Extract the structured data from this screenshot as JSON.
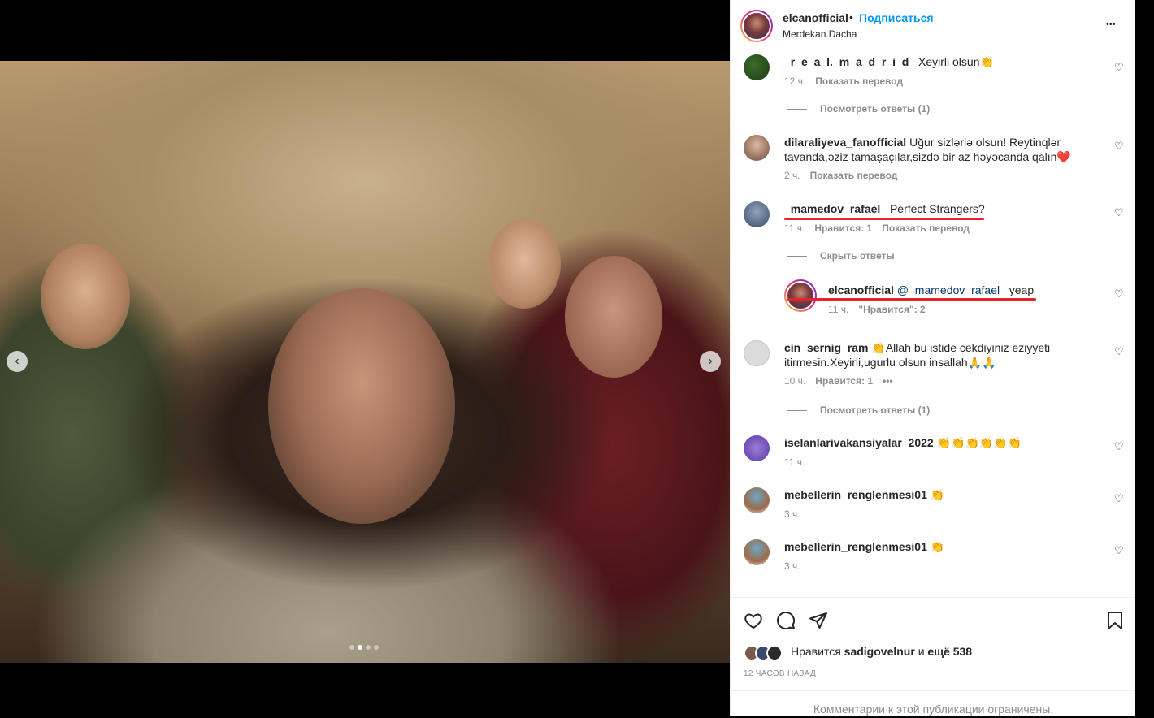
{
  "post": {
    "username": "elcanofficial",
    "separator": "•",
    "follow_label": "Подписаться",
    "location": "Merdekan.Dacha",
    "more_label": "•••"
  },
  "media": {
    "prev_label": "‹",
    "next_label": "›",
    "slide_count": 4,
    "active_slide": 1
  },
  "comments": [
    {
      "user": "_r_e_a_l._m_a_d_r_i_d_",
      "text": "Xeyirli olsun👏",
      "time": "12 ч.",
      "actions": [
        "Показать перевод"
      ],
      "replies_label": "Посмотреть ответы (1)"
    },
    {
      "user": "dilaraliyeva_fanofficial",
      "text": "Uğur sizlərlə olsun! Reytinqlər tavanda,əziz tamaşaçılar,sizdə bir az həyəcanda qalın❤️",
      "time": "2 ч.",
      "actions": [
        "Показать перевод"
      ]
    },
    {
      "user": "_mamedov_rafael_",
      "text": "Perfect Strangers?",
      "time": "11 ч.",
      "actions": [
        "Нравится: 1",
        "Показать перевод"
      ],
      "replies_label": "Скрыть ответы"
    },
    {
      "user": "elcanofficial",
      "mention": "@_mamedov_rafael_",
      "text": "yeap",
      "time": "11 ч.",
      "actions": [
        "\"Нравится\": 2"
      ]
    },
    {
      "user": "cin_sernig_ram",
      "text": "👏Allah bu istide cekdiyiniz eziyyeti itirmesin.Xeyirli,ugurlu olsun insallah🙏🙏",
      "time": "10 ч.",
      "actions": [
        "Нравится: 1",
        "•••"
      ],
      "replies_label": "Посмотреть ответы (1)"
    },
    {
      "user": "iselanlarivakansiyalar_2022",
      "text": "👏👏👏👏👏👏",
      "time": "11 ч.",
      "actions": []
    },
    {
      "user": "mebellerin_renglenmesi01",
      "text": "👏",
      "time": "3 ч.",
      "actions": []
    },
    {
      "user": "mebellerin_renglenmesi01",
      "text": "👏",
      "time": "3 ч.",
      "actions": []
    }
  ],
  "footer": {
    "likes_prefix": "Нравится",
    "likes_user": "sadigovelnur",
    "likes_and": "и",
    "likes_more": "ещё 538",
    "time_ago": "12 ЧАСОВ НАЗАД",
    "limited_text": "Комментарии к этой публикации ограничены."
  },
  "colors": {
    "accent": "#0095f6",
    "highlight": "#e8212b",
    "muted": "#8e8e8e"
  },
  "icons": [
    "heart-icon",
    "comment-icon",
    "share-icon",
    "bookmark-icon",
    "more-icon",
    "chevron-left-icon",
    "chevron-right-icon"
  ]
}
